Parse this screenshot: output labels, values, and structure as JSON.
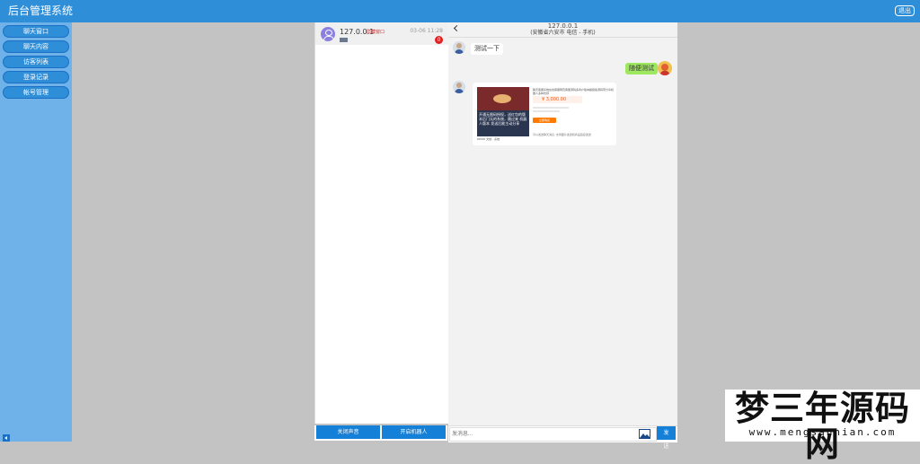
{
  "header": {
    "title": "后台管理系统",
    "logout_label": "退出"
  },
  "sidebar": {
    "items": [
      {
        "label": "聊天窗口"
      },
      {
        "label": "聊天内容"
      },
      {
        "label": "访客列表"
      },
      {
        "label": "登录记录"
      },
      {
        "label": "帐号管理"
      }
    ]
  },
  "session_list": {
    "items": [
      {
        "ip": "127.0.0.1",
        "tag": "隐藏窗口",
        "time": "03-06 11:28",
        "unread": "0"
      }
    ],
    "buttons": {
      "mute_label": "关闭声音",
      "robot_label": "开启机器人"
    }
  },
  "chat": {
    "header": {
      "ip": "127.0.0.1",
      "location": "(安徽省六安市 电信 - 手机)"
    },
    "messages": [
      {
        "side": "in",
        "text": "测试一下"
      },
      {
        "side": "out",
        "text": "随便测试"
      }
    ],
    "product_card": {
      "image_text": "开通无限码授权，送红包的版本后门无的系统，跳过来 机器人版本 发送后能主动分享",
      "image_caption": "DEMO 文档 - 系统",
      "title": "聊天客服系统在线客服网页客服源码多商户版本超级版源码带分享机器人多种支持",
      "price": "¥ 3,000.00",
      "buy_label": "立即购买",
      "footer": "可以发送聊天消息, 支持图片发送和商品链接发送"
    },
    "input": {
      "placeholder": "发消息...",
      "send_label": "发送"
    }
  },
  "watermark": {
    "main": "梦三年源码网",
    "url": "www.mengsannian.com"
  },
  "colors": {
    "topbar": "#2f8ed8",
    "sidebar": "#6fb2ea",
    "button": "#1580d8",
    "badge": "#e02020"
  }
}
